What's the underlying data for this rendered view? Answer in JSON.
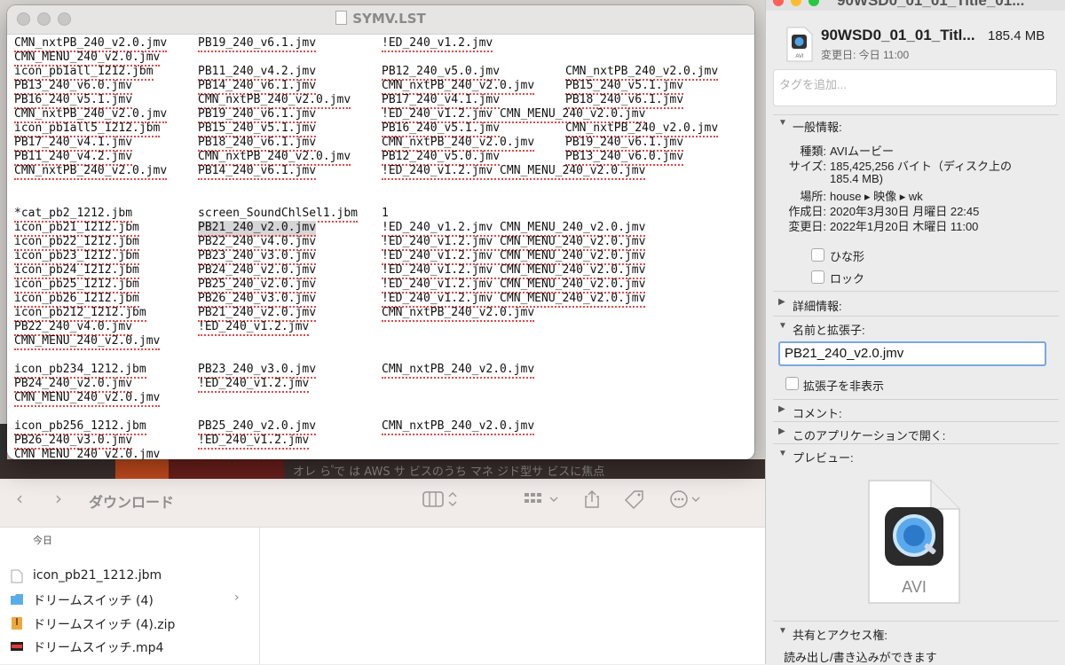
{
  "finder": {
    "title": "ダウンロード",
    "group_label": "今日",
    "background_text": "オレ  ら  ゚で は   AWS サ  ビスのうち    マネ   ジド型サ  ビスに焦点",
    "files": [
      {
        "name": "icon_pb21_1212.jbm",
        "type": "document"
      },
      {
        "name": "ドリームスイッチ (4)",
        "type": "folder"
      },
      {
        "name": "ドリームスイッチ (4).zip",
        "type": "zip"
      },
      {
        "name": "ドリームスイッチ.mp4",
        "type": "video"
      }
    ]
  },
  "editor": {
    "title": "SYMV.LST",
    "lines": [
      [
        "CMN_nxtPB_240_v2.0.jmv",
        "PB19_240_v6.1.jmv",
        "!ED_240_v1.2.jmv",
        ""
      ],
      [
        "CMN_MENU_240_v2.0.jmv",
        "",
        "",
        ""
      ],
      [
        "icon_pb1all_1212.jbm",
        "PB11_240_v4.2.jmv",
        "PB12_240_v5.0.jmv",
        "CMN_nxtPB_240_v2.0.jmv"
      ],
      [
        "PB13_240_v6.0.jmv",
        "PB14_240_v6.1.jmv",
        "CMN_nxtPB_240_v2.0.jmv",
        "PB15_240_v5.1.jmv"
      ],
      [
        "PB16_240_v5.1.jmv",
        "CMN_nxtPB_240_v2.0.jmv",
        "PB17_240_v4.1.jmv",
        "PB18_240_v6.1.jmv"
      ],
      [
        "CMN_nxtPB_240_v2.0.jmv",
        "PB19_240_v6.1.jmv",
        "!ED_240_v1.2.jmv CMN_MENU_240_v2.0.jmv",
        ""
      ],
      [
        "icon_pb1all5_1212.jbm",
        "PB15_240_v5.1.jmv",
        "PB16_240_v5.1.jmv",
        "CMN_nxtPB_240_v2.0.jmv"
      ],
      [
        "PB17_240_v4.1.jmv",
        "PB18_240_v6.1.jmv",
        "CMN_nxtPB_240_v2.0.jmv",
        "PB19_240_v6.1.jmv"
      ],
      [
        "PB11_240_v4.2.jmv",
        "CMN_nxtPB_240_v2.0.jmv",
        "PB12_240_v5.0.jmv",
        "PB13_240_v6.0.jmv"
      ],
      [
        "CMN_nxtPB_240_v2.0.jmv",
        "PB14_240_v6.1.jmv",
        "!ED_240_v1.2.jmv CMN_MENU_240_v2.0.jmv",
        ""
      ],
      [
        "",
        "",
        "",
        ""
      ],
      [
        "",
        "",
        "",
        ""
      ],
      [
        "*cat_pb2_1212.jbm",
        "screen_SoundChlSel1.jbm",
        "1",
        ""
      ],
      [
        "icon_pb21_1212.jbm",
        "PB21_240_v2.0.jmv",
        "!ED_240_v1.2.jmv CMN_MENU_240_v2.0.jmv",
        ""
      ],
      [
        "icon_pb22_1212.jbm",
        "PB22_240_v4.0.jmv",
        "!ED_240_v1.2.jmv CMN_MENU_240_v2.0.jmv",
        ""
      ],
      [
        "icon_pb23_1212.jbm",
        "PB23_240_v3.0.jmv",
        "!ED_240_v1.2.jmv CMN_MENU_240_v2.0.jmv",
        ""
      ],
      [
        "icon_pb24_1212.jbm",
        "PB24_240_v2.0.jmv",
        "!ED_240_v1.2.jmv CMN_MENU_240_v2.0.jmv",
        ""
      ],
      [
        "icon_pb25_1212.jbm",
        "PB25_240_v2.0.jmv",
        "!ED_240_v1.2.jmv CMN_MENU_240_v2.0.jmv",
        ""
      ],
      [
        "icon_pb26_1212.jbm",
        "PB26_240_v3.0.jmv",
        "!ED_240_v1.2.jmv CMN_MENU_240_v2.0.jmv",
        ""
      ],
      [
        "icon_pb212_1212.jbm",
        "PB21_240_v2.0.jmv",
        "CMN_nxtPB_240_v2.0.jmv",
        ""
      ],
      [
        "PB22_240_v4.0.jmv",
        "!ED_240_v1.2.jmv",
        "",
        ""
      ],
      [
        "CMN_MENU_240_v2.0.jmv",
        "",
        "",
        ""
      ],
      [
        "",
        "",
        "",
        ""
      ],
      [
        "icon_pb234_1212.jbm",
        "PB23_240_v3.0.jmv",
        "CMN_nxtPB_240_v2.0.jmv",
        ""
      ],
      [
        "PB24_240_v2.0.jmv",
        "!ED_240_v1.2.jmv",
        "",
        ""
      ],
      [
        "CMN_MENU_240_v2.0.jmv",
        "",
        "",
        ""
      ],
      [
        "",
        "",
        "",
        ""
      ],
      [
        "icon_pb256_1212.jbm",
        "PB25_240_v2.0.jmv",
        "CMN_nxtPB_240_v2.0.jmv",
        ""
      ],
      [
        "PB26_240_v3.0.jmv",
        "!ED_240_v1.2.jmv",
        "",
        ""
      ],
      [
        "CMN_MENU_240_v2.0.jmv",
        "",
        "",
        ""
      ]
    ],
    "selected_text": "PB21_240_v2.0.jmv"
  },
  "info_panel": {
    "window_title": "90WSD0_01_01_Title_01...",
    "file_name": "90WSD0_01_01_Titl...",
    "file_size": "185.4 MB",
    "modified_short": "変更日: 今日 11:00",
    "tag_placeholder": "タグを追加...",
    "general": {
      "title": "一般情報:",
      "kind_label": "種類:",
      "kind_value": "AVIムービー",
      "size_label": "サイズ:",
      "size_value": "185,425,256 バイト（ディスク上の",
      "size_value2": "185.4 MB)",
      "where_label": "場所:",
      "where_value": "house ▸ 映像 ▸ wk",
      "created_label": "作成日:",
      "created_value": "2020年3月30日 月曜日 22:45",
      "modified_label": "変更日:",
      "modified_value": "2022年1月20日 木曜日 11:00",
      "stationery": "ひな形",
      "locked": "ロック"
    },
    "more_info": "詳細情報:",
    "name_ext": {
      "title": "名前と拡張子:",
      "value": "PB21_240_v2.0.jmv",
      "hide_ext": "拡張子を非表示"
    },
    "comments": "コメント:",
    "open_with": "このアプリケーションで開く:",
    "preview": {
      "title": "プレビュー:",
      "label": "AVI"
    },
    "sharing": {
      "title": "共有とアクセス権:",
      "text": "読み出し/書き込みができます"
    },
    "icon_label": "AVI"
  }
}
